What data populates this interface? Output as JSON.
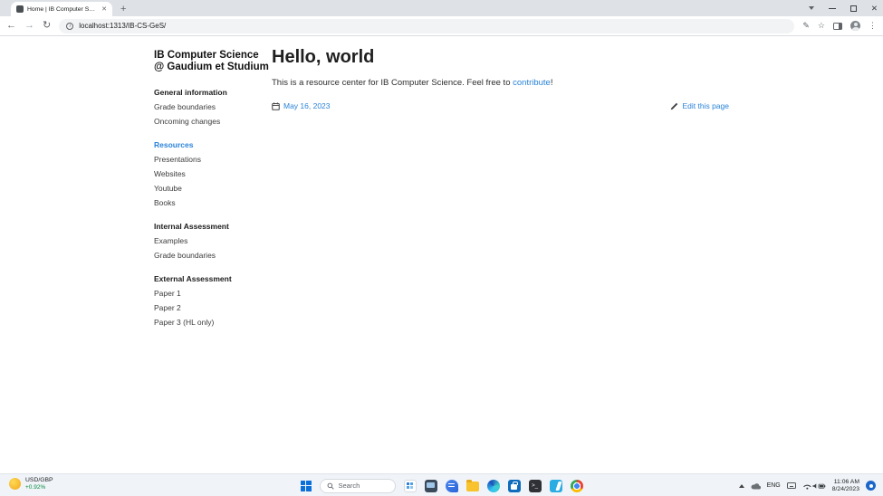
{
  "colors": {
    "accent": "#2a83d8",
    "positive_green": "#0a8a3c",
    "taskbar_bg": "#f0f4f9"
  },
  "browser": {
    "tab_title": "Home | IB Computer Science @",
    "url": "localhost:1313/IB-CS-GeS/"
  },
  "sidebar": {
    "title_line1": "IB Computer Science",
    "title_line2": "@ Gaudium et Studium",
    "sections": [
      {
        "heading": "General information",
        "items": [
          "Grade boundaries",
          "Oncoming changes"
        ]
      },
      {
        "heading": "Resources",
        "items": [
          "Presentations",
          "Websites",
          "Youtube",
          "Books"
        ]
      },
      {
        "heading": "Internal Assessment",
        "items": [
          "Examples",
          "Grade boundaries"
        ]
      },
      {
        "heading": "External Assessment",
        "items": [
          "Paper 1",
          "Paper 2",
          "Paper 3 (HL only)"
        ]
      }
    ]
  },
  "main": {
    "title": "Hello, world",
    "intro_before": "This is a resource center for IB Computer Science. Feel free to ",
    "intro_link": "contribute",
    "intro_after": "!",
    "date": "May 16, 2023",
    "edit_label": "Edit this page"
  },
  "taskbar": {
    "widget": {
      "pair": "USD/GBP",
      "change": "+0.92%"
    },
    "search_placeholder": "Search",
    "terminal_glyph": "&gt;_",
    "language": "ENG",
    "time": "11:06 AM",
    "date": "8/24/2023"
  }
}
